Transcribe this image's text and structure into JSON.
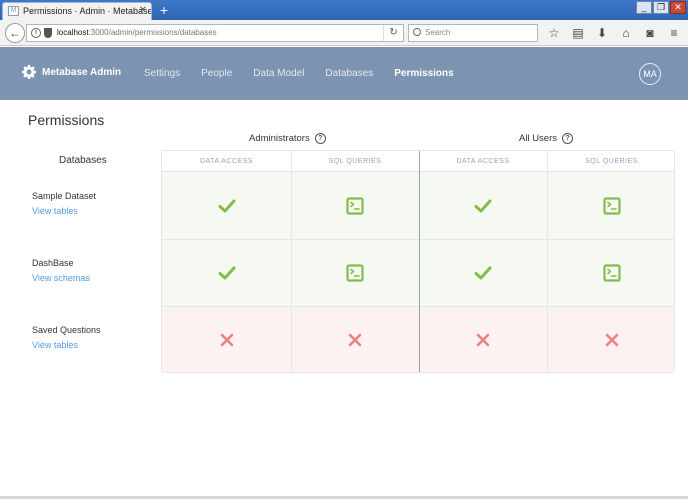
{
  "browser": {
    "tab_title": "Permissions · Admin · Metabase",
    "new_tab": "+",
    "url_host": "localhost",
    "url_path": ":3000/admin/permissions/databases",
    "search_placeholder": "Search"
  },
  "header": {
    "brand": "Metabase Admin",
    "nav": [
      "Settings",
      "People",
      "Data Model",
      "Databases",
      "Permissions"
    ],
    "active_nav": "Permissions",
    "avatar": "MA"
  },
  "page": {
    "title": "Permissions",
    "databases_heading": "Databases",
    "groups": [
      "Administrators",
      "All Users"
    ],
    "columns": [
      "DATA ACCESS",
      "SQL QUERIES",
      "DATA ACCESS",
      "SQL QUERIES"
    ],
    "rows": [
      {
        "name": "Sample Dataset",
        "link": "View tables",
        "cells": [
          "check",
          "sql",
          "check",
          "sql"
        ],
        "status": "granted"
      },
      {
        "name": "DashBase",
        "link": "View schemas",
        "cells": [
          "check",
          "sql",
          "check",
          "sql"
        ],
        "status": "granted"
      },
      {
        "name": "Saved Questions",
        "link": "View tables",
        "cells": [
          "cross",
          "cross",
          "cross",
          "cross"
        ],
        "status": "denied"
      }
    ]
  },
  "colors": {
    "header_bg": "#7d93b2",
    "granted": "#84bb4c",
    "denied": "#ed8080",
    "link": "#509ee3"
  }
}
